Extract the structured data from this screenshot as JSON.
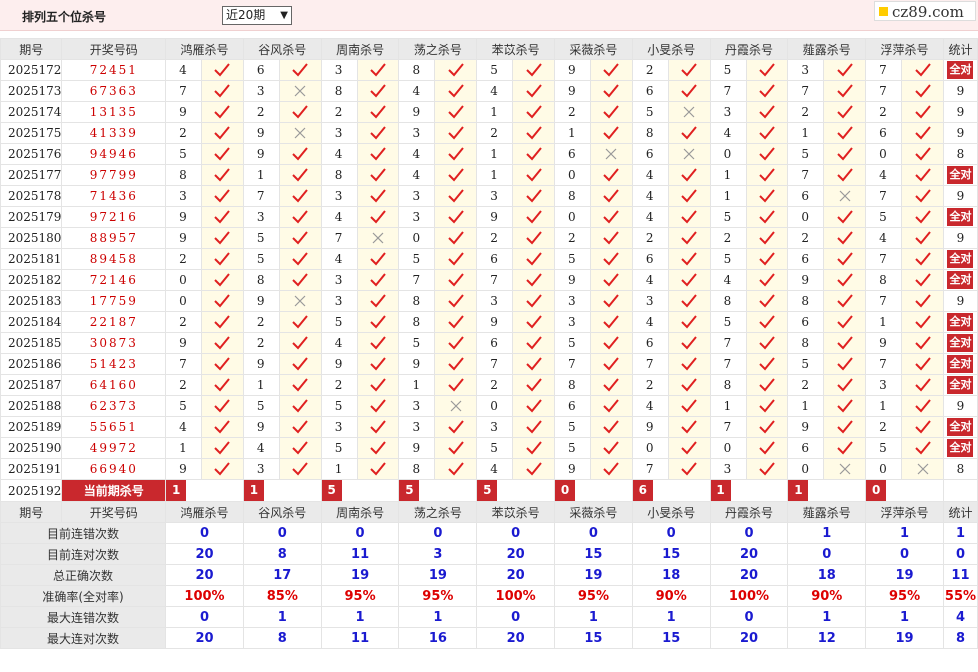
{
  "header": {
    "title": "排列五个位杀号",
    "period_select": "近20期",
    "site_logo": "cz89.com",
    "logo_color": "#ffcc00"
  },
  "columns": [
    "期号",
    "开奖号码",
    "鸿雁杀号",
    "谷风杀号",
    "周南杀号",
    "荡之杀号",
    "苯苡杀号",
    "采薇杀号",
    "小旻杀号",
    "丹霞杀号",
    "薤露杀号",
    "浮萍杀号",
    "统计"
  ],
  "all_correct_label": "全对",
  "rows": [
    {
      "issue": "2025172",
      "draw": "72451",
      "kills": [
        4,
        6,
        3,
        8,
        5,
        9,
        2,
        5,
        3,
        7
      ],
      "ok": [
        1,
        1,
        1,
        1,
        1,
        1,
        1,
        1,
        1,
        1
      ],
      "stat": "全对"
    },
    {
      "issue": "2025173",
      "draw": "67363",
      "kills": [
        7,
        3,
        8,
        4,
        4,
        9,
        6,
        7,
        7,
        7
      ],
      "ok": [
        1,
        0,
        1,
        1,
        1,
        1,
        1,
        1,
        1,
        1
      ],
      "stat": "9"
    },
    {
      "issue": "2025174",
      "draw": "13135",
      "kills": [
        9,
        2,
        2,
        9,
        1,
        2,
        5,
        3,
        2,
        2
      ],
      "ok": [
        1,
        1,
        1,
        1,
        1,
        1,
        0,
        1,
        1,
        1
      ],
      "stat": "9"
    },
    {
      "issue": "2025175",
      "draw": "41339",
      "kills": [
        2,
        9,
        3,
        3,
        2,
        1,
        8,
        4,
        1,
        6
      ],
      "ok": [
        1,
        0,
        1,
        1,
        1,
        1,
        1,
        1,
        1,
        1
      ],
      "stat": "9"
    },
    {
      "issue": "2025176",
      "draw": "94946",
      "kills": [
        5,
        9,
        4,
        4,
        1,
        6,
        6,
        0,
        5,
        0
      ],
      "ok": [
        1,
        1,
        1,
        1,
        1,
        0,
        0,
        1,
        1,
        1
      ],
      "stat": "8"
    },
    {
      "issue": "2025177",
      "draw": "97799",
      "kills": [
        8,
        1,
        8,
        4,
        1,
        0,
        4,
        1,
        7,
        4
      ],
      "ok": [
        1,
        1,
        1,
        1,
        1,
        1,
        1,
        1,
        1,
        1
      ],
      "stat": "全对"
    },
    {
      "issue": "2025178",
      "draw": "71436",
      "kills": [
        3,
        7,
        3,
        3,
        3,
        8,
        4,
        1,
        6,
        7
      ],
      "ok": [
        1,
        1,
        1,
        1,
        1,
        1,
        1,
        1,
        0,
        1
      ],
      "stat": "9"
    },
    {
      "issue": "2025179",
      "draw": "97216",
      "kills": [
        9,
        3,
        4,
        3,
        9,
        0,
        4,
        5,
        0,
        5
      ],
      "ok": [
        1,
        1,
        1,
        1,
        1,
        1,
        1,
        1,
        1,
        1
      ],
      "stat": "全对"
    },
    {
      "issue": "2025180",
      "draw": "88957",
      "kills": [
        9,
        5,
        7,
        0,
        2,
        2,
        2,
        2,
        2,
        4
      ],
      "ok": [
        1,
        1,
        0,
        1,
        1,
        1,
        1,
        1,
        1,
        1
      ],
      "stat": "9"
    },
    {
      "issue": "2025181",
      "draw": "89458",
      "kills": [
        2,
        5,
        4,
        5,
        6,
        5,
        6,
        5,
        6,
        7
      ],
      "ok": [
        1,
        1,
        1,
        1,
        1,
        1,
        1,
        1,
        1,
        1
      ],
      "stat": "全对"
    },
    {
      "issue": "2025182",
      "draw": "72146",
      "kills": [
        0,
        8,
        3,
        7,
        7,
        9,
        4,
        4,
        9,
        8
      ],
      "ok": [
        1,
        1,
        1,
        1,
        1,
        1,
        1,
        1,
        1,
        1
      ],
      "stat": "全对"
    },
    {
      "issue": "2025183",
      "draw": "17759",
      "kills": [
        0,
        9,
        3,
        8,
        3,
        3,
        3,
        8,
        8,
        7
      ],
      "ok": [
        1,
        0,
        1,
        1,
        1,
        1,
        1,
        1,
        1,
        1
      ],
      "stat": "9"
    },
    {
      "issue": "2025184",
      "draw": "22187",
      "kills": [
        2,
        2,
        5,
        8,
        9,
        3,
        4,
        5,
        6,
        1
      ],
      "ok": [
        1,
        1,
        1,
        1,
        1,
        1,
        1,
        1,
        1,
        1
      ],
      "stat": "全对"
    },
    {
      "issue": "2025185",
      "draw": "30873",
      "kills": [
        9,
        2,
        4,
        5,
        6,
        5,
        6,
        7,
        8,
        9
      ],
      "ok": [
        1,
        1,
        1,
        1,
        1,
        1,
        1,
        1,
        1,
        1
      ],
      "stat": "全对"
    },
    {
      "issue": "2025186",
      "draw": "51423",
      "kills": [
        7,
        9,
        9,
        9,
        7,
        7,
        7,
        7,
        5,
        7
      ],
      "ok": [
        1,
        1,
        1,
        1,
        1,
        1,
        1,
        1,
        1,
        1
      ],
      "stat": "全对"
    },
    {
      "issue": "2025187",
      "draw": "64160",
      "kills": [
        2,
        1,
        2,
        1,
        2,
        8,
        2,
        8,
        2,
        3
      ],
      "ok": [
        1,
        1,
        1,
        1,
        1,
        1,
        1,
        1,
        1,
        1
      ],
      "stat": "全对"
    },
    {
      "issue": "2025188",
      "draw": "62373",
      "kills": [
        5,
        5,
        5,
        3,
        0,
        6,
        4,
        1,
        1,
        1
      ],
      "ok": [
        1,
        1,
        1,
        0,
        1,
        1,
        1,
        1,
        1,
        1
      ],
      "stat": "9"
    },
    {
      "issue": "2025189",
      "draw": "55651",
      "kills": [
        4,
        9,
        3,
        3,
        3,
        5,
        9,
        7,
        9,
        2
      ],
      "ok": [
        1,
        1,
        1,
        1,
        1,
        1,
        1,
        1,
        1,
        1
      ],
      "stat": "全对"
    },
    {
      "issue": "2025190",
      "draw": "49972",
      "kills": [
        1,
        4,
        5,
        9,
        5,
        5,
        0,
        0,
        6,
        5
      ],
      "ok": [
        1,
        1,
        1,
        1,
        1,
        1,
        1,
        1,
        1,
        1
      ],
      "stat": "全对"
    },
    {
      "issue": "2025191",
      "draw": "66940",
      "kills": [
        9,
        3,
        1,
        8,
        4,
        9,
        7,
        3,
        0,
        0
      ],
      "ok": [
        1,
        1,
        1,
        1,
        1,
        1,
        1,
        1,
        0,
        0
      ],
      "stat": "8"
    }
  ],
  "current": {
    "issue": "2025192",
    "label": "当前期杀号",
    "kills": [
      "1",
      "1",
      "5",
      "5",
      "5",
      "0",
      "6",
      "1",
      "1",
      "0"
    ]
  },
  "summary": [
    {
      "label": "目前连错次数",
      "vals": [
        "0",
        "0",
        "0",
        "0",
        "0",
        "0",
        "0",
        "0",
        "1",
        "1",
        "1"
      ]
    },
    {
      "label": "目前连对次数",
      "vals": [
        "20",
        "8",
        "11",
        "3",
        "20",
        "15",
        "15",
        "20",
        "0",
        "0",
        "0"
      ]
    },
    {
      "label": "总正确次数",
      "vals": [
        "20",
        "17",
        "19",
        "19",
        "20",
        "19",
        "18",
        "20",
        "18",
        "19",
        "11"
      ]
    },
    {
      "label": "准确率(全对率)",
      "vals": [
        "100%",
        "85%",
        "95%",
        "95%",
        "100%",
        "95%",
        "90%",
        "100%",
        "90%",
        "95%",
        "55%"
      ]
    },
    {
      "label": "最大连错次数",
      "vals": [
        "0",
        "1",
        "1",
        "1",
        "0",
        "1",
        "1",
        "0",
        "1",
        "1",
        "4"
      ]
    },
    {
      "label": "最大连对次数",
      "vals": [
        "20",
        "8",
        "11",
        "16",
        "20",
        "15",
        "15",
        "20",
        "12",
        "19",
        "8"
      ]
    }
  ]
}
